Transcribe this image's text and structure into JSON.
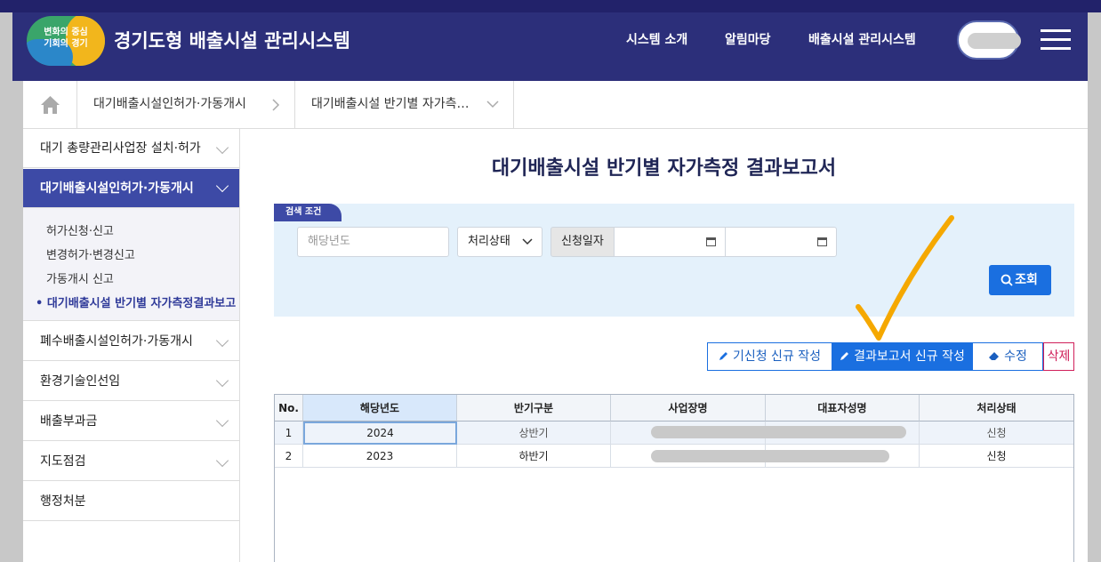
{
  "header": {
    "logo_line1": "변화의 중심",
    "logo_line2": "기회의 경기",
    "title": "경기도형 배출시설 관리시스템",
    "nav": [
      "시스템 소개",
      "알림마당",
      "배출시설 관리시스템"
    ]
  },
  "breadcrumb": {
    "items": [
      "대기배출시설인허가·가동개시",
      "대기배출시설 반기별 자가측…"
    ]
  },
  "sidebar": {
    "items": [
      "대기 총량관리사업장 설치·허가",
      "대기배출시설인허가·가동개시",
      "폐수배출시설인허가·가동개시",
      "환경기술인선임",
      "배출부과금",
      "지도점검",
      "행정처분"
    ],
    "sub_items": [
      "허가신청·신고",
      "변경허가·변경신고",
      "가동개시 신고",
      "• 대기배출시설 반기별 자가측정결과보고"
    ]
  },
  "main": {
    "page_title": "대기배출시설 반기별 자가측정 결과보고서",
    "search": {
      "tab_label": "검색 조건",
      "year_placeholder": "해당년도",
      "status_select": "처리상태",
      "date_label": "신청일자",
      "search_button": "조회"
    },
    "actions": {
      "existing_new": "기신청 신규 작성",
      "report_new": "결과보고서 신규 작성",
      "edit": "수정",
      "delete": "삭제"
    },
    "table": {
      "columns": [
        "No.",
        "해당년도",
        "반기구분",
        "사업장명",
        "대표자성명",
        "처리상태"
      ],
      "rows": [
        {
          "no": "1",
          "year": "2024",
          "half": "상반기",
          "status": "신청"
        },
        {
          "no": "2",
          "year": "2023",
          "half": "하반기",
          "status": "신청"
        }
      ]
    }
  },
  "colors": {
    "header": "#2c2f7a",
    "accent": "#3d4aa6",
    "primary_button": "#1a6fe0",
    "delete": "#d0205a",
    "annotation": "#f5a800"
  }
}
